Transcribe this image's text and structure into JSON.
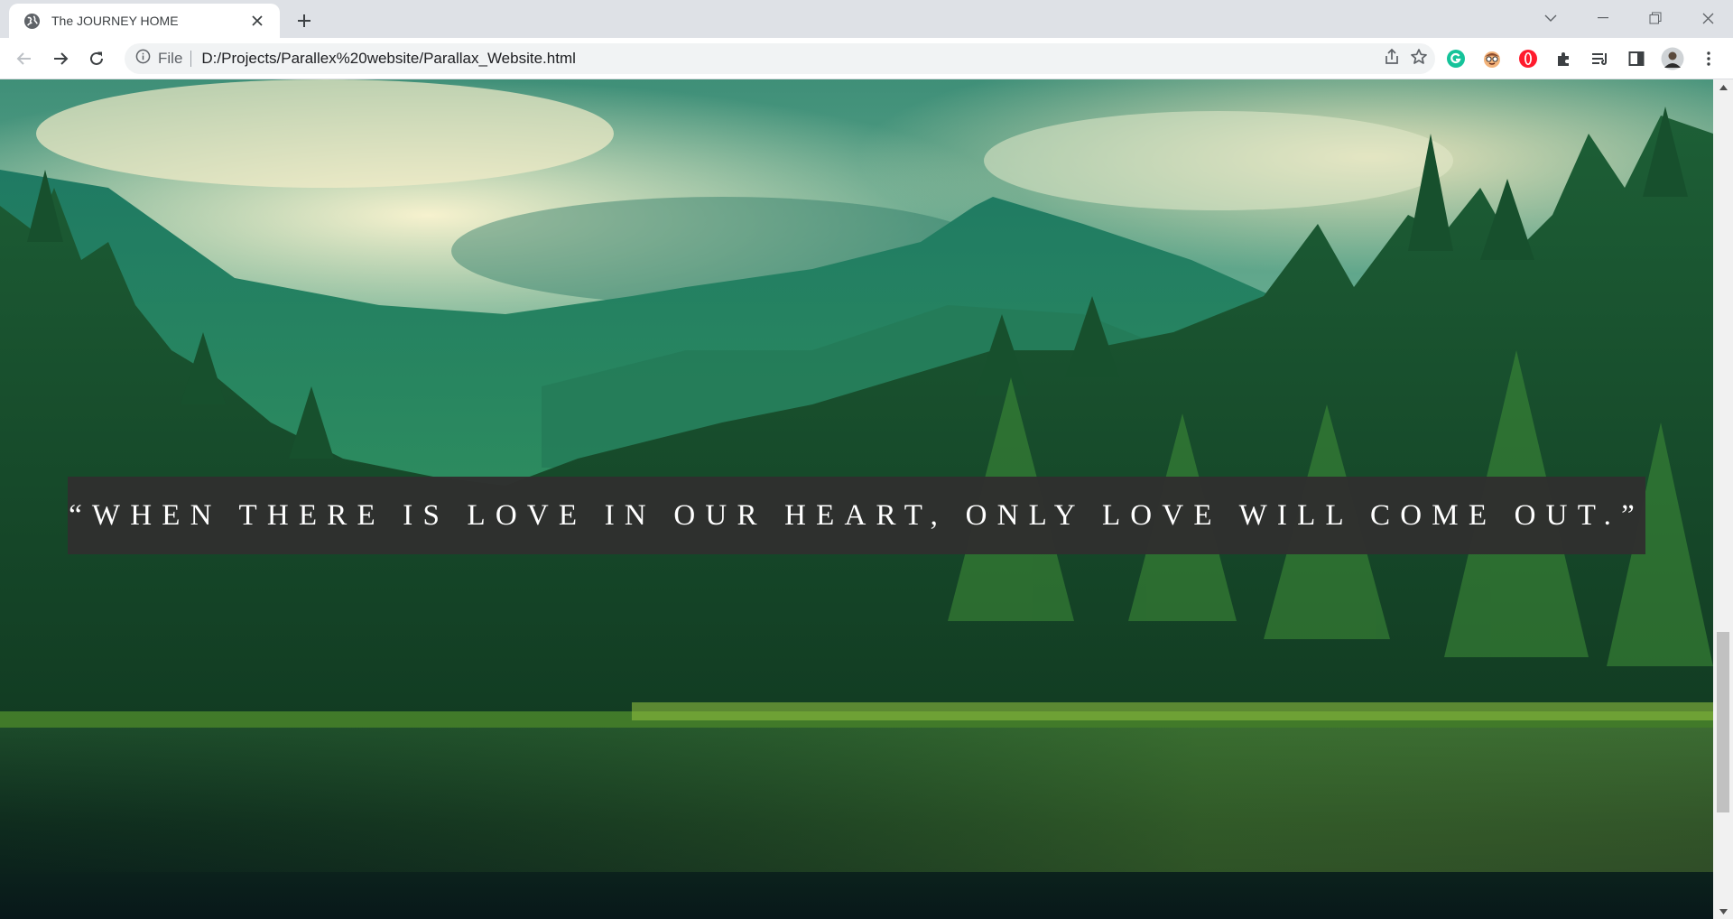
{
  "browser": {
    "tab_title": "The JOURNEY HOME",
    "scheme_label": "File",
    "url": "D:/Projects/Parallex%20website/Parallax_Website.html"
  },
  "page": {
    "quote": "“WHEN THERE IS LOVE IN OUR HEART, ONLY LOVE WILL COME OUT.”"
  },
  "scroll_position_fraction": 0.62,
  "colors": {
    "quote_box": "#30302e",
    "tabstrip": "#dee1e6",
    "grammarly": "#15c39a",
    "opera": "#ff1b2d"
  },
  "icons": {
    "favicon": "globe-icon",
    "extensions": [
      "grammarly-icon",
      "face-extension-icon",
      "opera-icon",
      "puzzle-icon",
      "reading-list-icon",
      "side-panel-icon",
      "profile-avatar",
      "kebab-menu-icon"
    ]
  }
}
